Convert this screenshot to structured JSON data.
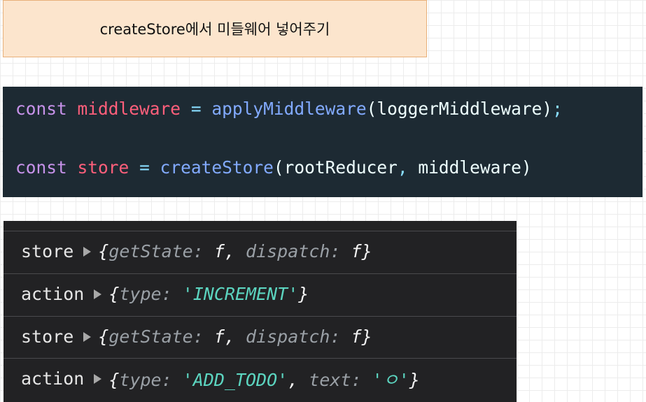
{
  "note": {
    "title": "createStore에서 미들웨어 넣어주기"
  },
  "code": {
    "line1": {
      "keyword": "const",
      "variable": "middleware",
      "operator": "=",
      "function": "applyMiddleware",
      "args": "(loggerMiddleware)",
      "terminator": ";"
    },
    "line2": {
      "keyword": "const",
      "variable": "store",
      "operator": "=",
      "function": "createStore",
      "args_open": "(rootReducer",
      "separator": ",",
      "args_close": " middleware)"
    }
  },
  "console": {
    "rows": [
      {
        "label": "store",
        "open": "{",
        "k1": "getState",
        "v1": "f",
        "k2": "dispatch",
        "v2": "f",
        "close": "}"
      },
      {
        "label": "action",
        "open": "{",
        "k1": "type",
        "v1": "'INCREMENT'",
        "close": "}"
      },
      {
        "label": "store",
        "open": "{",
        "k1": "getState",
        "v1": "f",
        "k2": "dispatch",
        "v2": "f",
        "close": "}"
      },
      {
        "label": "action",
        "open": "{",
        "k1": "type",
        "v1": "'ADD_TODO'",
        "k2": "text",
        "v2": "'ㅇ'",
        "close": "}"
      }
    ]
  },
  "colors": {
    "keyword": "#c792ea",
    "variable": "#ff5f7b",
    "operator": "#89ddff",
    "function": "#82aaff",
    "string": "#5cd5c0",
    "note_background": "#fce5cd"
  },
  "icons": {
    "expand": "disclosure-triangle-icon"
  }
}
